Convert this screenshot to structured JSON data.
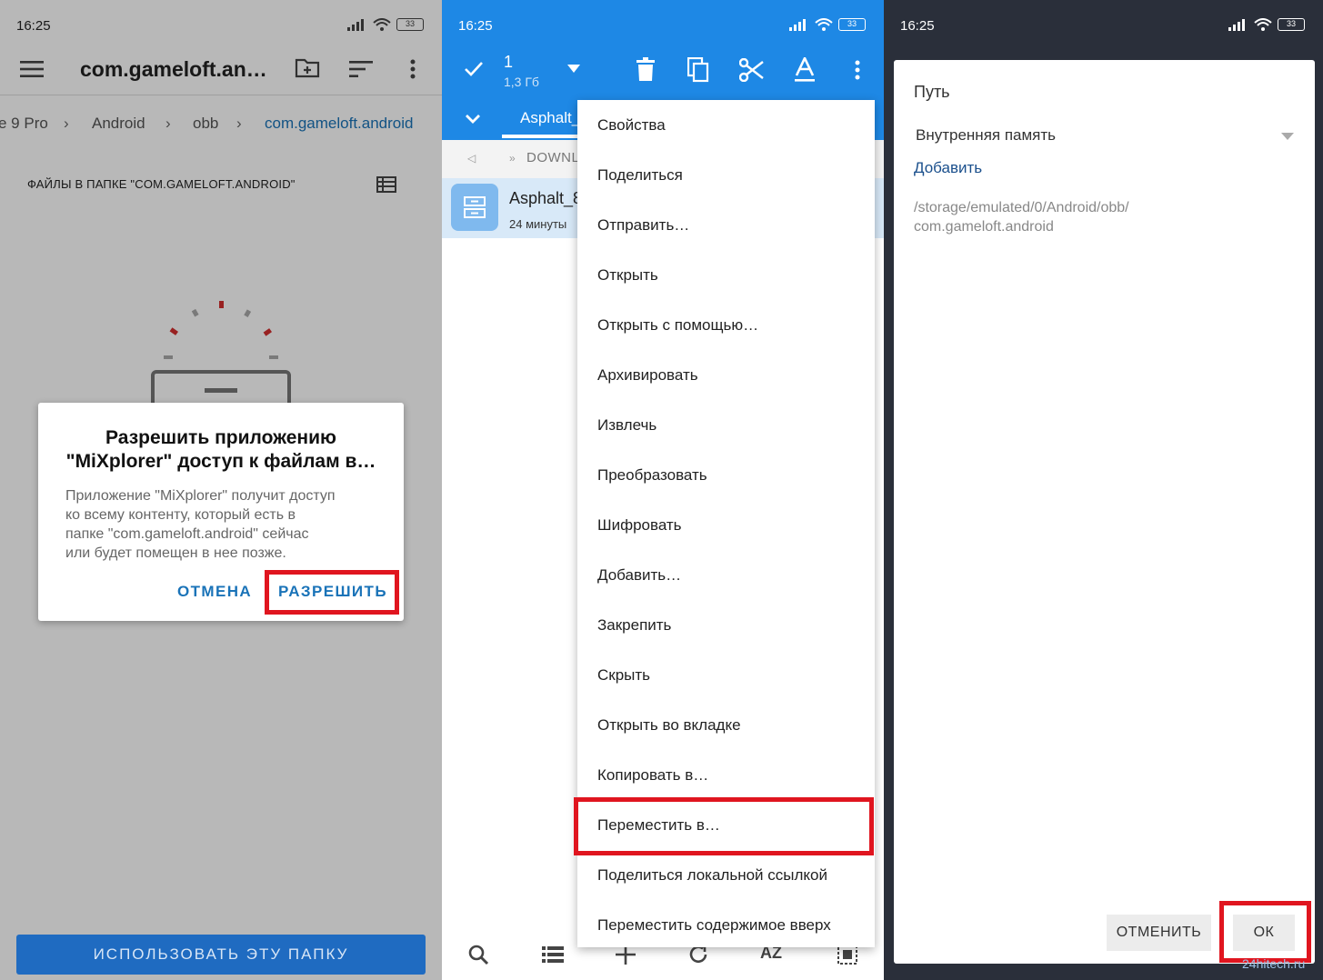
{
  "status": {
    "time": "16:25",
    "battery": "33"
  },
  "left_screen": {
    "title": "com.gameloft.an…",
    "breadcrumb": [
      "e 9 Pro",
      "Android",
      "obb",
      "com.gameloft.android"
    ],
    "section_header": "ФАЙЛЫ В ПАПКЕ \"COM.GAMELOFT.ANDROID\"",
    "dialog": {
      "title_line1": "Разрешить приложению",
      "title_line2": "\"MiXplorer\" доступ к файлам в…",
      "body_line1": "Приложение \"MiXplorer\" получит доступ",
      "body_line2": "ко всему контенту, который есть в",
      "body_line3": "папке \"com.gameloft.android\" сейчас",
      "body_line4": "или будет помещен в нее позже.",
      "cancel_label": "ОТМЕНА",
      "allow_label": "РАЗРЕШИТЬ"
    },
    "use_folder_label": "ИСПОЛЬЗОВАТЬ ЭТУ ПАПКУ"
  },
  "middle_screen": {
    "selection_count": "1",
    "selection_size": "1,3 Гб",
    "tab_label": "Asphalt_",
    "path_label": "DOWNL",
    "file_name": "Asphalt_8",
    "file_time": "24 минуты",
    "menu_items": [
      "Свойства",
      "Поделиться",
      "Отправить…",
      "Открыть",
      "Открыть с помощью…",
      "Архивировать",
      "Извлечь",
      "Преобразовать",
      "Шифровать",
      "Добавить…",
      "Закрепить",
      "Скрыть",
      "Открыть во вкладке",
      "Копировать в…",
      "Переместить в…",
      "Поделиться локальной ссылкой",
      "Переместить содержимое вверх"
    ],
    "bottom_sort_label": "AZ"
  },
  "right_screen": {
    "dialog_title": "Путь",
    "storage_select": "Внутренняя память",
    "add_link": "Добавить",
    "path_line1": "/storage/emulated/0/Android/obb/",
    "path_line2": "com.gameloft.android",
    "cancel_label": "ОТМЕНИТЬ",
    "ok_label": "ОК",
    "watermark": "24hitech.ru"
  },
  "colors": {
    "accent_blue": "#1e88e5",
    "highlight_red": "#e0151f",
    "link_blue": "#1a73b8"
  }
}
